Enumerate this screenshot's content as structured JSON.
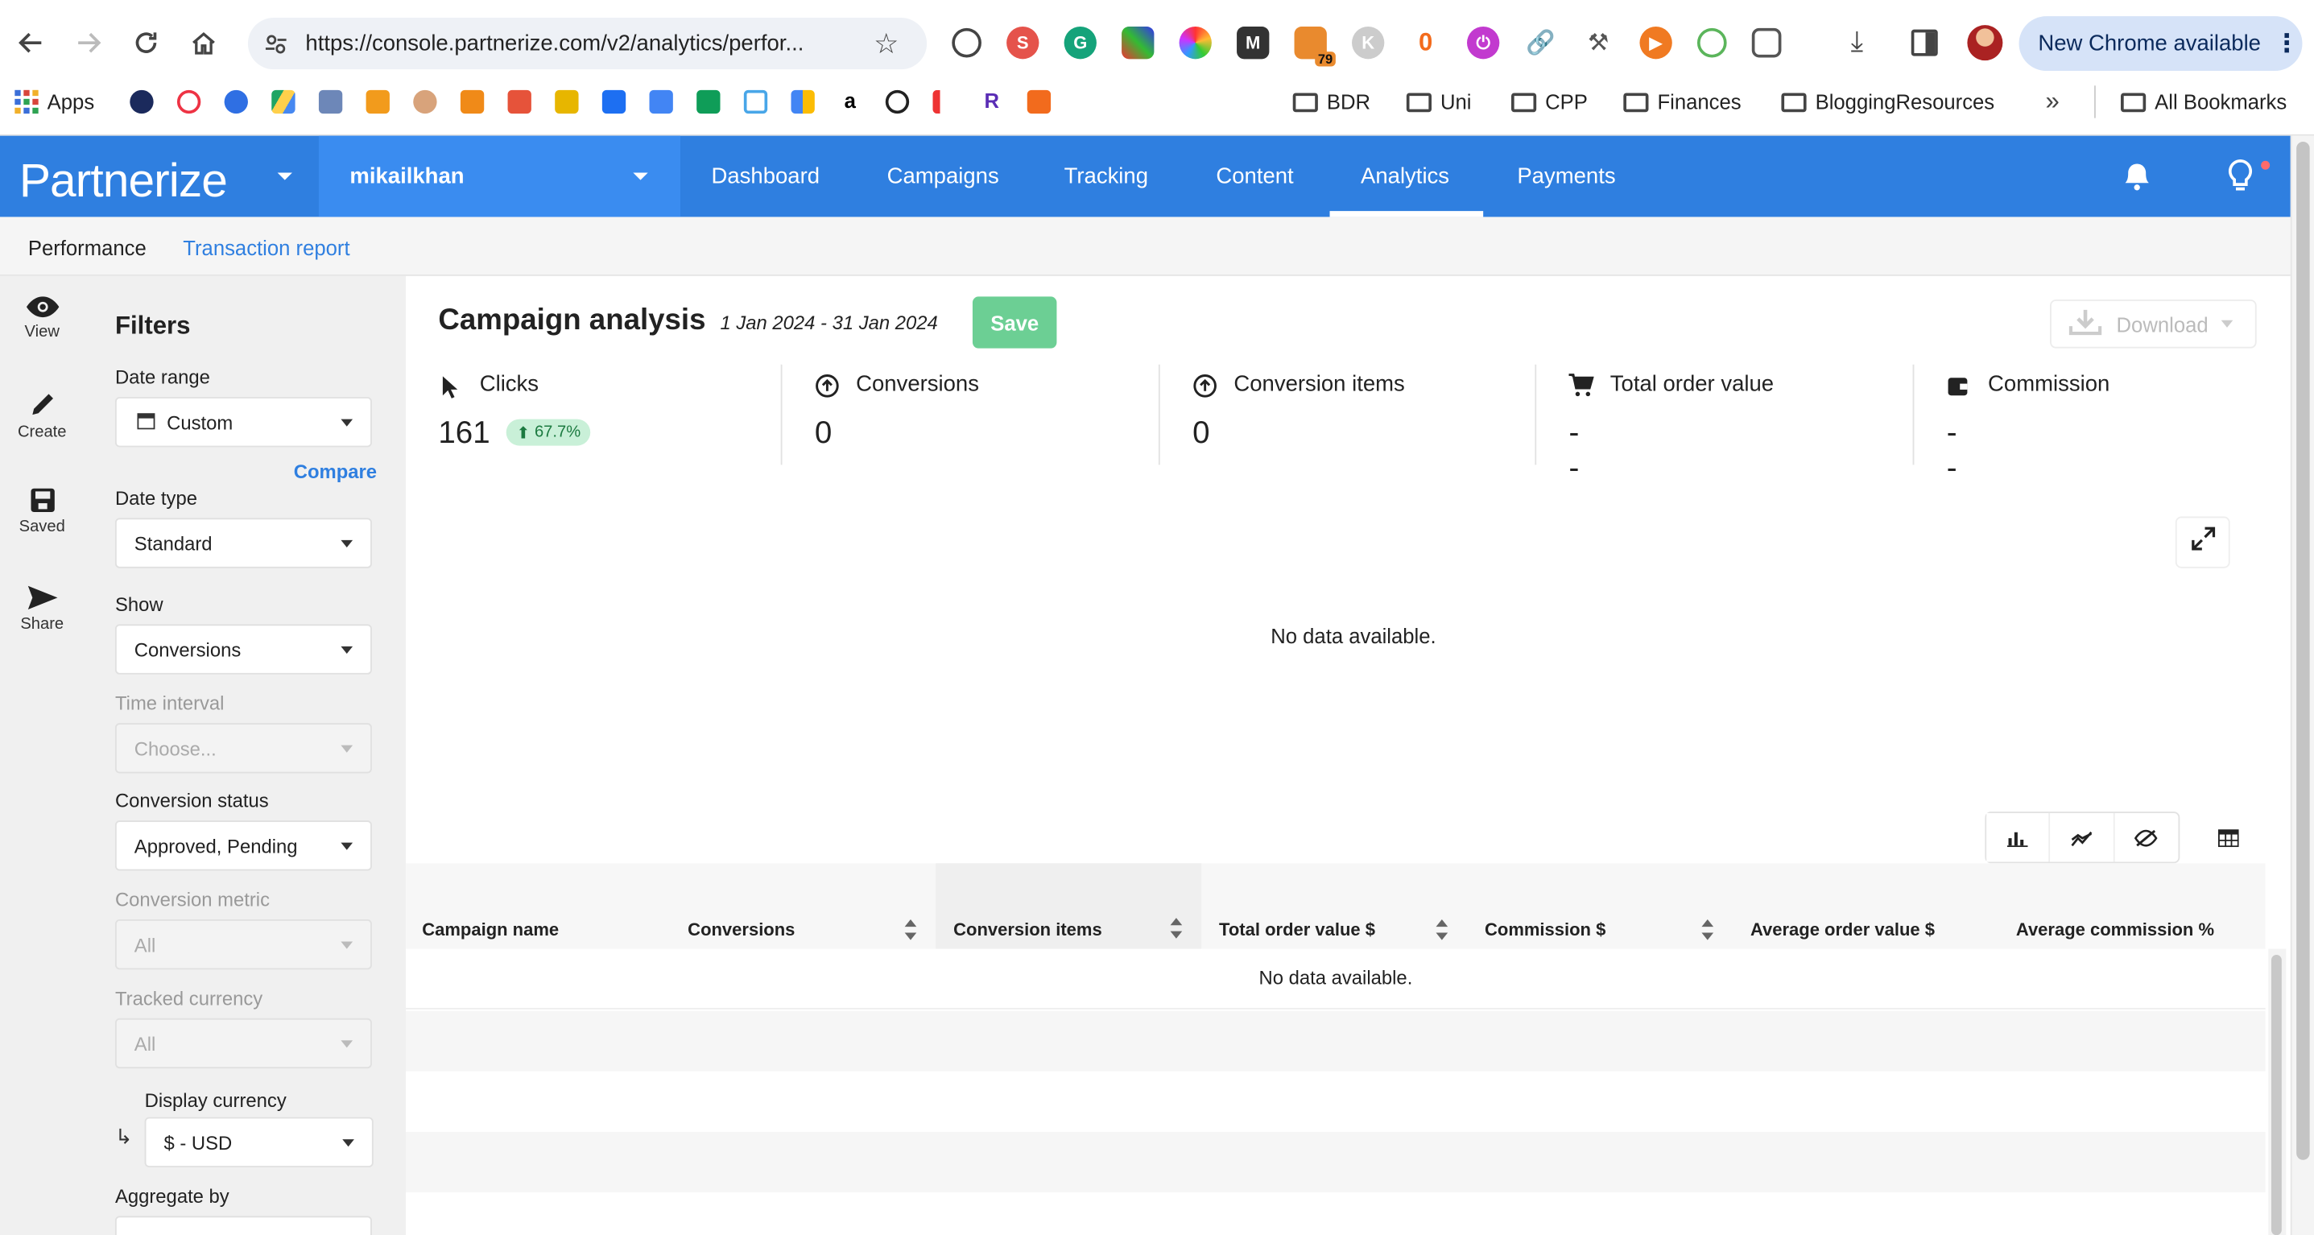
{
  "browser": {
    "url": "https://console.partnerize.com/v2/analytics/perfor...",
    "new_chrome": "New Chrome available",
    "ext_badge": "79",
    "bookmarks": [
      "Apps",
      "BDR",
      "Uni",
      "CPP",
      "Finances",
      "BloggingResources",
      "All Bookmarks"
    ]
  },
  "app": {
    "logo": "Partnerize",
    "account": "mikailkhan",
    "nav": [
      "Dashboard",
      "Campaigns",
      "Tracking",
      "Content",
      "Analytics",
      "Payments"
    ],
    "subnav": [
      "Performance",
      "Transaction report"
    ]
  },
  "rail": [
    "View",
    "Create",
    "Saved",
    "Share"
  ],
  "filters": {
    "title": "Filters",
    "date_range_label": "Date range",
    "date_range_value": "Custom",
    "compare": "Compare",
    "date_type_label": "Date type",
    "date_type_value": "Standard",
    "show_label": "Show",
    "show_value": "Conversions",
    "time_interval_label": "Time interval",
    "time_interval_value": "Choose...",
    "conv_status_label": "Conversion status",
    "conv_status_value": "Approved, Pending",
    "conv_metric_label": "Conversion metric",
    "conv_metric_value": "All",
    "tracked_currency_label": "Tracked currency",
    "tracked_currency_value": "All",
    "display_currency_label": "Display currency",
    "display_currency_value": "$ - USD",
    "aggregate_label": "Aggregate by"
  },
  "main": {
    "title": "Campaign analysis",
    "date_range": "1 Jan 2024 - 31 Jan 2024",
    "save": "Save",
    "download": "Download",
    "metrics": [
      {
        "label": "Clicks",
        "value": "161",
        "badge": "67.7%"
      },
      {
        "label": "Conversions",
        "value": "0"
      },
      {
        "label": "Conversion items",
        "value": "0"
      },
      {
        "label": "Total order value",
        "value": "--"
      },
      {
        "label": "Commission",
        "value": "--"
      }
    ],
    "chart_empty": "No data available.",
    "table_empty": "No data available.",
    "columns": [
      "Campaign name",
      "Conversions",
      "Conversion items",
      "Total order value $",
      "Commission $",
      "Average order value $",
      "Average commission %"
    ]
  },
  "colors": {
    "brand": "#2f7fe0",
    "save": "#6ccf94",
    "badge_bg": "#c9f0d8",
    "badge_fg": "#1c7a40"
  }
}
